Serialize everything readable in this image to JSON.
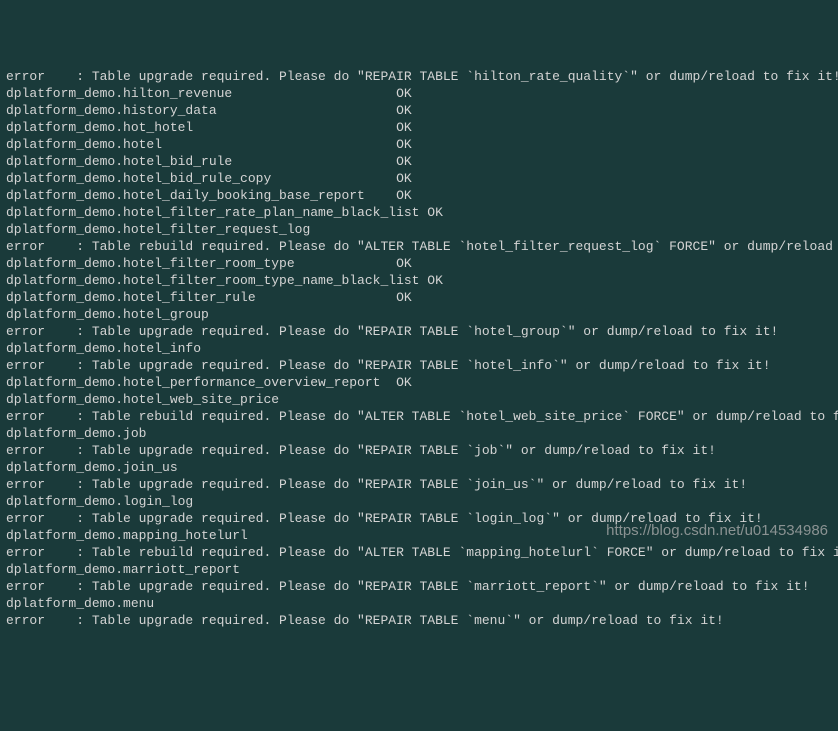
{
  "watermark": "https://blog.csdn.net/u014534986",
  "lines": [
    "error    : Table upgrade required. Please do \"REPAIR TABLE `hilton_rate_quality`\" or dump/reload to fix it!",
    "dplatform_demo.hilton_revenue                     OK",
    "dplatform_demo.history_data                       OK",
    "dplatform_demo.hot_hotel                          OK",
    "dplatform_demo.hotel                              OK",
    "dplatform_demo.hotel_bid_rule                     OK",
    "dplatform_demo.hotel_bid_rule_copy                OK",
    "dplatform_demo.hotel_daily_booking_base_report    OK",
    "dplatform_demo.hotel_filter_rate_plan_name_black_list OK",
    "dplatform_demo.hotel_filter_request_log",
    "error    : Table rebuild required. Please do \"ALTER TABLE `hotel_filter_request_log` FORCE\" or dump/reload to fix it!",
    "dplatform_demo.hotel_filter_room_type             OK",
    "dplatform_demo.hotel_filter_room_type_name_black_list OK",
    "dplatform_demo.hotel_filter_rule                  OK",
    "dplatform_demo.hotel_group",
    "error    : Table upgrade required. Please do \"REPAIR TABLE `hotel_group`\" or dump/reload to fix it!",
    "dplatform_demo.hotel_info",
    "error    : Table upgrade required. Please do \"REPAIR TABLE `hotel_info`\" or dump/reload to fix it!",
    "dplatform_demo.hotel_performance_overview_report  OK",
    "dplatform_demo.hotel_web_site_price",
    "error    : Table rebuild required. Please do \"ALTER TABLE `hotel_web_site_price` FORCE\" or dump/reload to fix it!",
    "dplatform_demo.job",
    "error    : Table upgrade required. Please do \"REPAIR TABLE `job`\" or dump/reload to fix it!",
    "dplatform_demo.join_us",
    "error    : Table upgrade required. Please do \"REPAIR TABLE `join_us`\" or dump/reload to fix it!",
    "dplatform_demo.login_log",
    "error    : Table upgrade required. Please do \"REPAIR TABLE `login_log`\" or dump/reload to fix it!",
    "dplatform_demo.mapping_hotelurl",
    "error    : Table rebuild required. Please do \"ALTER TABLE `mapping_hotelurl` FORCE\" or dump/reload to fix it!",
    "dplatform_demo.marriott_report",
    "error    : Table upgrade required. Please do \"REPAIR TABLE `marriott_report`\" or dump/reload to fix it!",
    "dplatform_demo.menu",
    "error    : Table upgrade required. Please do \"REPAIR TABLE `menu`\" or dump/reload to fix it!"
  ]
}
